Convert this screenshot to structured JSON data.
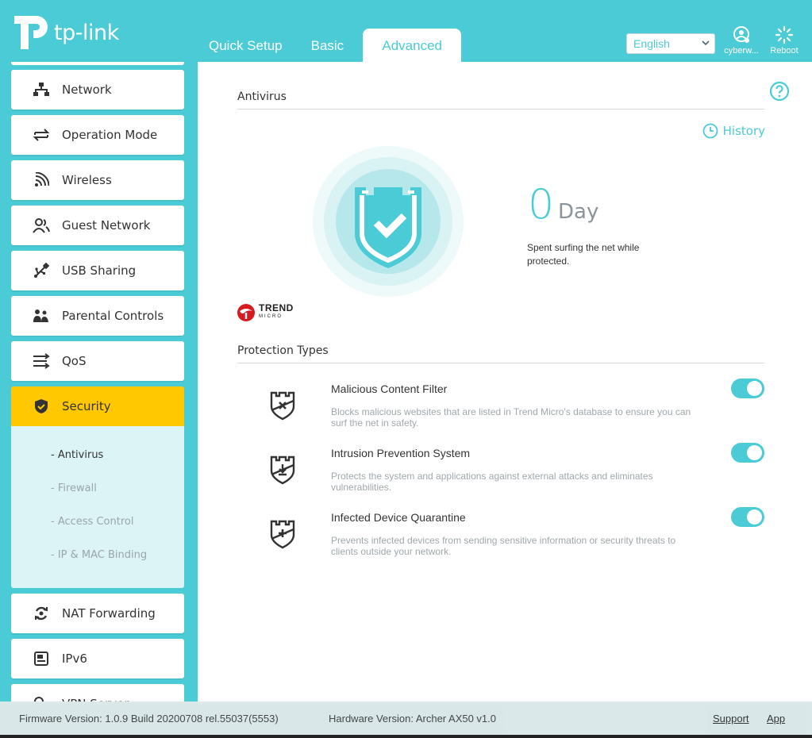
{
  "header": {
    "logo_text": "tp-link",
    "tabs": [
      {
        "label": "Quick Setup",
        "active": false
      },
      {
        "label": "Basic",
        "active": false
      },
      {
        "label": "Advanced",
        "active": true
      }
    ],
    "language": "English",
    "user_label": "cyberw...",
    "reboot_label": "Reboot"
  },
  "sidebar": {
    "items": [
      {
        "label": "Network",
        "icon": "network-icon"
      },
      {
        "label": "Operation Mode",
        "icon": "operation-mode-icon"
      },
      {
        "label": "Wireless",
        "icon": "wireless-icon"
      },
      {
        "label": "Guest Network",
        "icon": "guest-network-icon"
      },
      {
        "label": "USB Sharing",
        "icon": "usb-icon"
      },
      {
        "label": "Parental Controls",
        "icon": "parental-controls-icon"
      },
      {
        "label": "QoS",
        "icon": "qos-icon"
      },
      {
        "label": "Security",
        "icon": "security-shield-icon",
        "active": true
      },
      {
        "label": "NAT Forwarding",
        "icon": "nat-forwarding-icon"
      },
      {
        "label": "IPv6",
        "icon": "ipv6-icon"
      },
      {
        "label": "VPN Server",
        "icon": "vpn-icon"
      }
    ],
    "security_sub": [
      {
        "label": "- Antivirus",
        "active": true
      },
      {
        "label": "- Firewall",
        "active": false
      },
      {
        "label": "- Access Control",
        "active": false
      },
      {
        "label": "- IP & MAC Binding",
        "active": false
      }
    ]
  },
  "main": {
    "antivirus_title": "Antivirus",
    "history_label": "History",
    "days_count": "0",
    "days_unit": "Day",
    "days_desc": "Spent surfing the net while protected.",
    "trend_line1": "TREND",
    "trend_line2": "MICRO",
    "protection_title": "Protection Types",
    "protection_types": [
      {
        "title": "Malicious Content Filter",
        "desc": "Blocks malicious websites that are listed in Trend Micro's database to ensure you can surf the net in safety.",
        "enabled": true
      },
      {
        "title": "Intrusion Prevention System",
        "desc": "Protects the system and applications against external attacks and eliminates vulnerabilities.",
        "enabled": true
      },
      {
        "title": "Infected Device Quarantine",
        "desc": "Prevents infected devices from sending sensitive information or security threats to clients outside your network.",
        "enabled": true
      }
    ]
  },
  "footer": {
    "firmware": "Firmware Version: 1.0.9 Build 20200708 rel.55037(5553)",
    "hardware": "Hardware Version: Archer AX50 v1.0",
    "support": "Support",
    "app": "App"
  },
  "colors": {
    "accent": "#4acbd6",
    "active_menu": "#ffc800"
  }
}
